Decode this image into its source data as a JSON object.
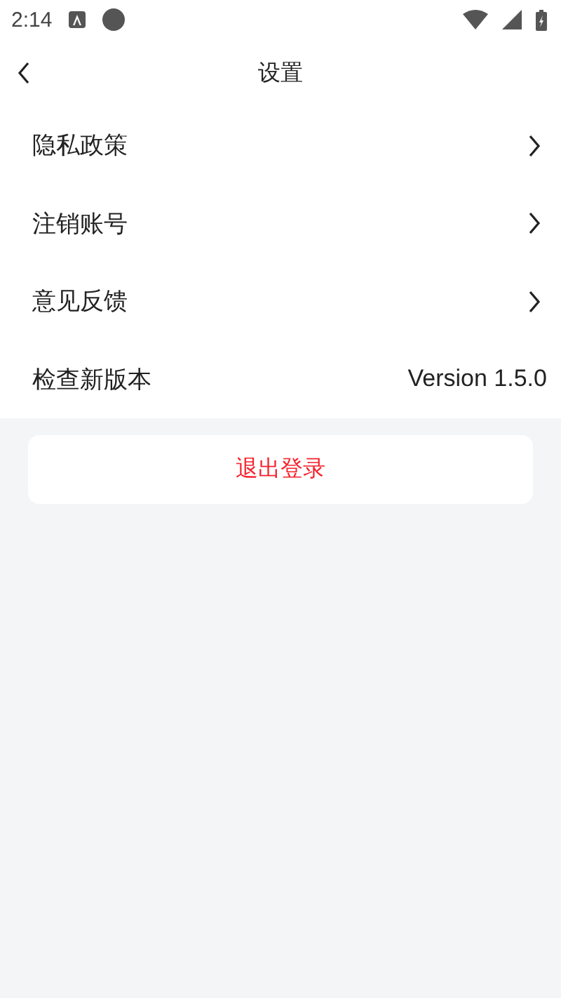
{
  "status_bar": {
    "time": "2:14"
  },
  "header": {
    "title": "设置"
  },
  "items": [
    {
      "kind": "link",
      "label": "隐私政策"
    },
    {
      "kind": "link",
      "label": "注销账号"
    },
    {
      "kind": "link",
      "label": "意见反馈"
    },
    {
      "kind": "value",
      "label": "检查新版本",
      "value": "Version 1.5.0"
    }
  ],
  "logout_button": "退出登录"
}
